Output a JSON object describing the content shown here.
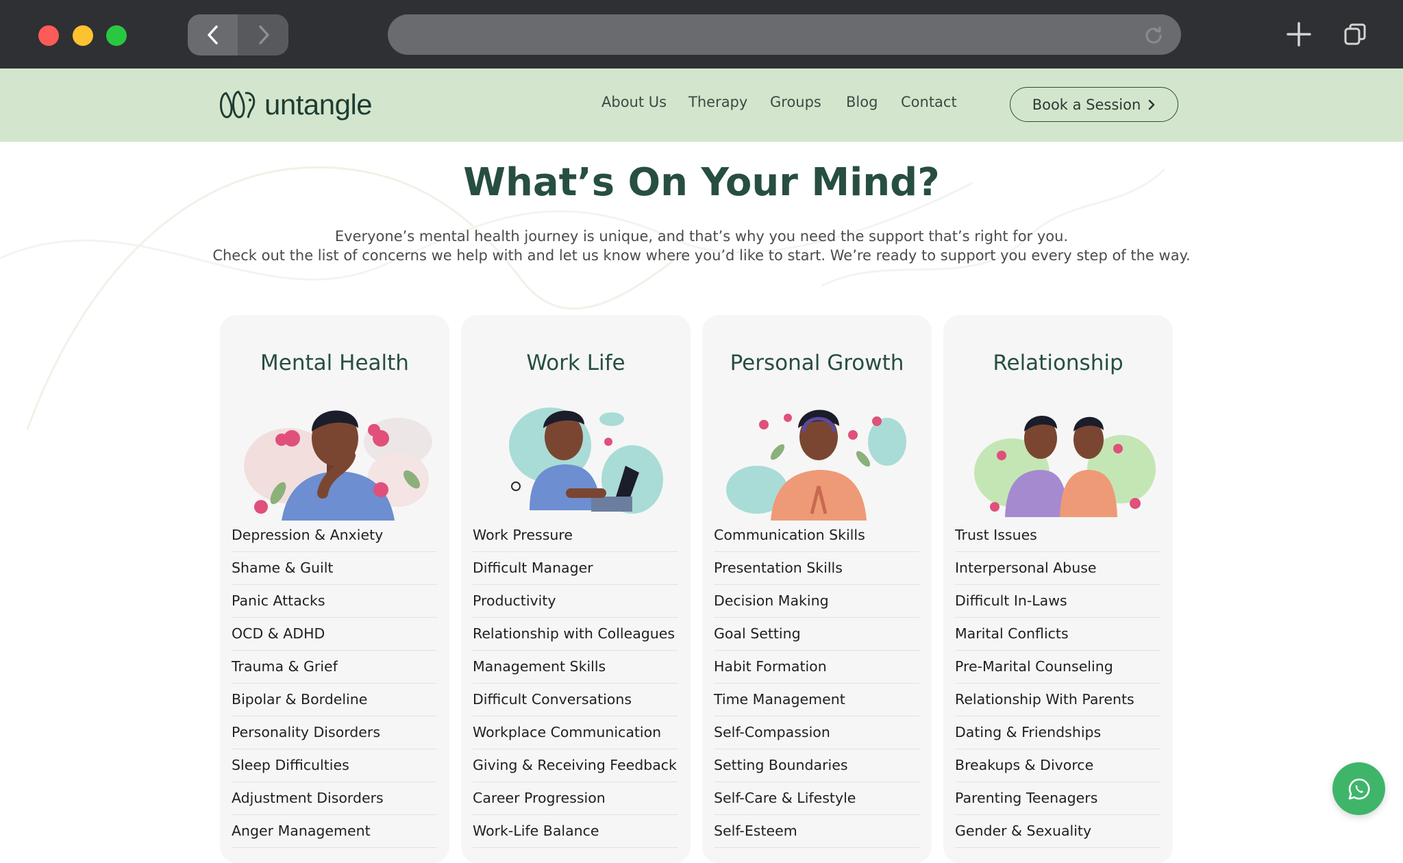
{
  "browser": {
    "icons": [
      "close-dot",
      "minimize-dot",
      "maximize-dot",
      "back-icon",
      "forward-icon",
      "reload-icon",
      "new-tab-icon",
      "tabs-icon"
    ]
  },
  "site": {
    "logo_text": "untangle",
    "nav": [
      "About Us",
      "Therapy",
      "Groups",
      "Blog",
      "Contact"
    ],
    "cta_label": "Book a Session",
    "brand_color": "#274e42",
    "header_bg": "#d3e6cd"
  },
  "hero": {
    "title": "What’s On Your Mind?",
    "subtitle_line1": "Everyone’s mental health journey is unique, and that’s why you need the support that’s right for you.",
    "subtitle_line2": "Check out the list of concerns we help with and let us know where you’d like to start. We’re ready to support you every step of the way."
  },
  "categories": [
    {
      "title": "Mental Health",
      "items": [
        "Depression & Anxiety",
        "Shame & Guilt",
        "Panic Attacks",
        "OCD & ADHD",
        "Trauma & Grief",
        "Bipolar & Bordeline",
        "Personality Disorders",
        "Sleep Difficulties",
        "Adjustment Disorders",
        "Anger Management"
      ]
    },
    {
      "title": "Work Life",
      "items": [
        "Work Pressure",
        "Difficult Manager",
        "Productivity",
        "Relationship with Colleagues",
        "Management Skills",
        "Difficult Conversations",
        "Workplace Communication",
        "Giving & Receiving Feedback",
        "Career Progression",
        "Work-Life Balance"
      ]
    },
    {
      "title": "Personal Growth",
      "items": [
        "Communication Skills",
        "Presentation Skills",
        "Decision Making",
        "Goal Setting",
        "Habit Formation",
        "Time Management",
        "Self-Compassion",
        "Setting Boundaries",
        "Self-Care & Lifestyle",
        "Self-Esteem"
      ]
    },
    {
      "title": "Relationship",
      "items": [
        "Trust Issues",
        "Interpersonal Abuse",
        "Difficult In-Laws",
        "Marital Conflicts",
        "Pre-Marital Counseling",
        "Relationship With Parents",
        "Dating & Friendships",
        "Breakups & Divorce",
        "Parenting Teenagers",
        "Gender & Sexuality"
      ]
    }
  ],
  "chat": {
    "icon": "whatsapp-icon",
    "color": "#3fb56a"
  }
}
